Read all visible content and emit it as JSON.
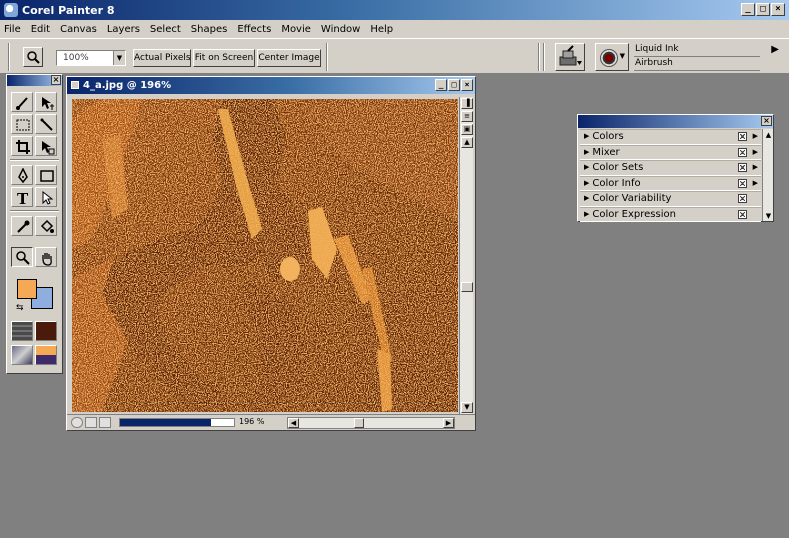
{
  "app": {
    "title": "Corel Painter 8",
    "controls": {
      "minimize": "_",
      "maximize": "□",
      "close": "×"
    }
  },
  "menu": {
    "items": [
      "File",
      "Edit",
      "Canvas",
      "Layers",
      "Select",
      "Shapes",
      "Effects",
      "Movie",
      "Window",
      "Help"
    ]
  },
  "propbar": {
    "zoom_value": "100%",
    "actual_pixels": "Actual Pixels",
    "fit_on_screen": "Fit on Screen",
    "center_image": "Center Image",
    "brush_category": "Liquid Ink",
    "brush_variant": "Airbrush"
  },
  "document": {
    "title": "4_a.jpg @ 196%",
    "status_zoom": "196 %"
  },
  "colors_palette": {
    "items": [
      "Colors",
      "Mixer",
      "Color Sets",
      "Color Info",
      "Color Variability",
      "Color Expression"
    ]
  },
  "colors": {
    "primary": "#f6a955",
    "secondary": "#8faedf",
    "canvas_dark": "#5c1f04",
    "canvas_mid": "#8a3a10",
    "canvas_light": "#d9802a"
  },
  "icons": {
    "toolbox": [
      "brush-icon",
      "layer-adjuster-icon",
      "rect-select-icon",
      "magic-wand-icon",
      "crop-icon",
      "transform-icon",
      "pen-icon",
      "shape-icon",
      "text-icon",
      "selector-icon",
      "dropper-icon",
      "bucket-icon",
      "magnifier-icon",
      "grabber-icon"
    ]
  }
}
